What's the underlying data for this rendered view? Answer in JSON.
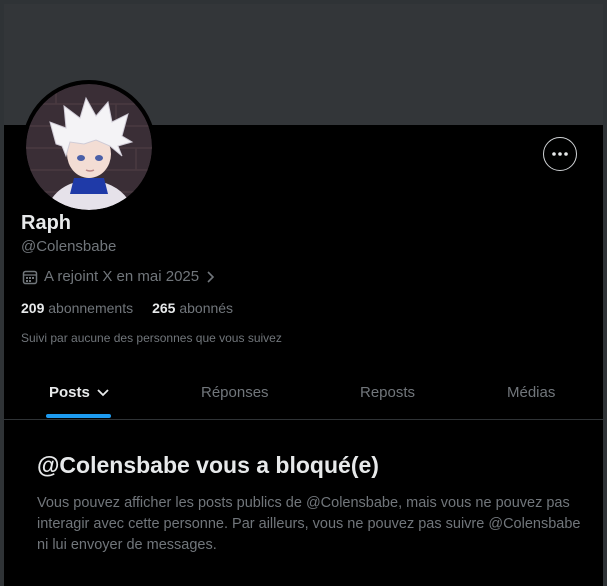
{
  "profile": {
    "name": "Raph",
    "handle": "@Colensbabe",
    "joined": "A rejoint X en mai 2025",
    "following_count": "209",
    "following_label": "abonnements",
    "followers_count": "265",
    "followers_label": "abonnés",
    "followed_by": "Suivi par aucune des personnes que vous suivez"
  },
  "tabs": [
    {
      "label": "Posts",
      "active": true
    },
    {
      "label": "Réponses"
    },
    {
      "label": "Reposts"
    },
    {
      "label": "Médias"
    }
  ],
  "blocked": {
    "title": "@Colensbabe vous a bloqué(e)",
    "text": "Vous pouvez afficher les posts publics de @Colensbabe, mais vous ne pouvez pas interagir avec cette personne. Par ailleurs, vous ne pouvez pas suivre @Colensbabe ni lui envoyer de messages."
  },
  "icons": {
    "more": "more-horizontal-icon",
    "calendar": "calendar-icon",
    "chevron": "chevron-right-icon",
    "dropdown": "chevron-down-icon"
  },
  "colors": {
    "background": "#000000",
    "banner": "#333639",
    "accent": "#1d9bf0",
    "text_primary": "#e7e9ea",
    "text_secondary": "#71767b"
  }
}
